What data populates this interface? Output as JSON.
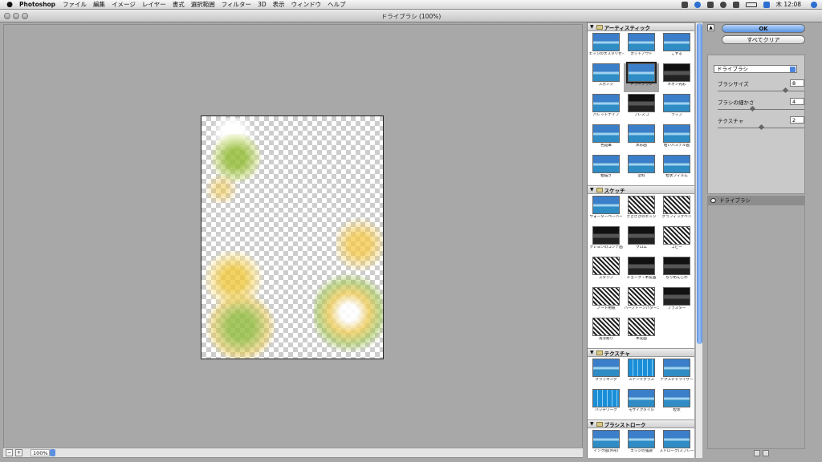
{
  "menubar": {
    "apple": "",
    "app": "Photoshop",
    "items": [
      "ファイル",
      "編集",
      "イメージ",
      "レイヤー",
      "書式",
      "選択範囲",
      "フィルター",
      "3D",
      "表示",
      "ウィンドウ",
      "ヘルプ"
    ],
    "clock": "木 12:08"
  },
  "window": {
    "title": "ドライブラシ (100%)"
  },
  "status": {
    "zoom": "100%"
  },
  "gallery": {
    "categories": [
      {
        "name": "アーティスティック",
        "items": [
          "エッジのポスタリゼーション",
          "カットアウト",
          "こする",
          "スポンジ",
          "ドライブラシ",
          "ネオン光彩",
          "パレットナイフ",
          "フレスコ",
          "ラップ",
          "色鉛筆",
          "水彩画",
          "粗いパステル画",
          "粗描き",
          "塗料",
          "粒状フィルム"
        ]
      },
      {
        "name": "スケッチ",
        "items": [
          "ウォーターペーパー",
          "ぎざぎざのエッジ",
          "グラフィックペン",
          "クレヨンのコンテ画",
          "クロム",
          "コピー",
          "スタンプ",
          "チョーク・木炭画",
          "ちりめんじわ",
          "ノート用紙",
          "ハーフトーンパターン",
          "プラスター",
          "浅浮彫り",
          "木炭画"
        ]
      },
      {
        "name": "テクスチャ",
        "items": [
          "クラッキング",
          "ステンドグラス",
          "テクスチャライザー",
          "パッチワーク",
          "モザイクタイル",
          "粒状"
        ]
      },
      {
        "name": "ブラシストローク",
        "items": [
          "インク画(外形)",
          "エッジの強調",
          "ストローク(スプレー)"
        ]
      }
    ],
    "selected": "ドライブラシ"
  },
  "panel": {
    "ok": "OK",
    "reset": "すべてクリア",
    "filter": "ドライブラシ",
    "params": [
      {
        "label": "ブラシサイズ",
        "value": "8",
        "fraction": 0.8
      },
      {
        "label": "ブラシの細かさ",
        "value": "4",
        "fraction": 0.4
      },
      {
        "label": "テクスチャ",
        "value": "2",
        "fraction": 0.5
      }
    ],
    "layer": "ドライブラシ"
  },
  "colors": {
    "accent": "#5a93e3",
    "canvas": "#a8a8a8"
  }
}
